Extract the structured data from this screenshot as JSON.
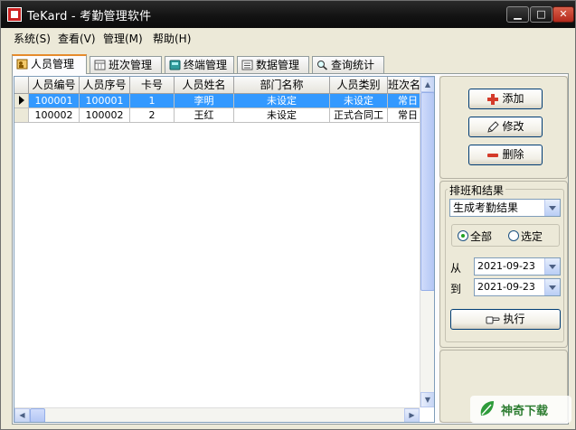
{
  "window": {
    "title": "TeKard - 考勤管理软件",
    "min_label": "▁",
    "max_label": "□",
    "close_label": "✕"
  },
  "menu": [
    {
      "label": "系统(S)"
    },
    {
      "label": "查看(V)"
    },
    {
      "label": "管理(M)"
    },
    {
      "label": "帮助(H)"
    }
  ],
  "tabs": [
    {
      "label": "人员管理",
      "active": true,
      "icon": "person-card-icon"
    },
    {
      "label": "班次管理",
      "icon": "calendar-icon"
    },
    {
      "label": "终端管理",
      "icon": "terminal-book-icon"
    },
    {
      "label": "数据管理",
      "icon": "data-list-icon"
    },
    {
      "label": "查询统计",
      "icon": "magnifier-icon"
    }
  ],
  "grid": {
    "columns": [
      "人员编号",
      "人员序号",
      "卡号",
      "人员姓名",
      "部门名称",
      "人员类别",
      "班次名称"
    ],
    "rows": [
      {
        "selected": true,
        "cells": [
          "100001",
          "100001",
          "1",
          "李明",
          "未设定",
          "未设定",
          "常日"
        ]
      },
      {
        "selected": false,
        "cells": [
          "100002",
          "100002",
          "2",
          "王红",
          "未设定",
          "正式合同工",
          "常日"
        ]
      }
    ]
  },
  "actions": {
    "add_label": "添加",
    "edit_label": "修改",
    "delete_label": "删除"
  },
  "schedule": {
    "group_label": "排班和结果",
    "mode_value": "生成考勤结果",
    "radio_all": "全部",
    "radio_selected": "选定",
    "from_label": "从",
    "to_label": "到",
    "from_date": "2021-09-23",
    "to_date": "2021-09-23",
    "execute_label": "执行"
  },
  "watermark": {
    "text": "神奇下载"
  },
  "colors": {
    "selection": "#3399ff",
    "accent_tab": "#e68b2c",
    "add_icon": "#d43a2a"
  }
}
